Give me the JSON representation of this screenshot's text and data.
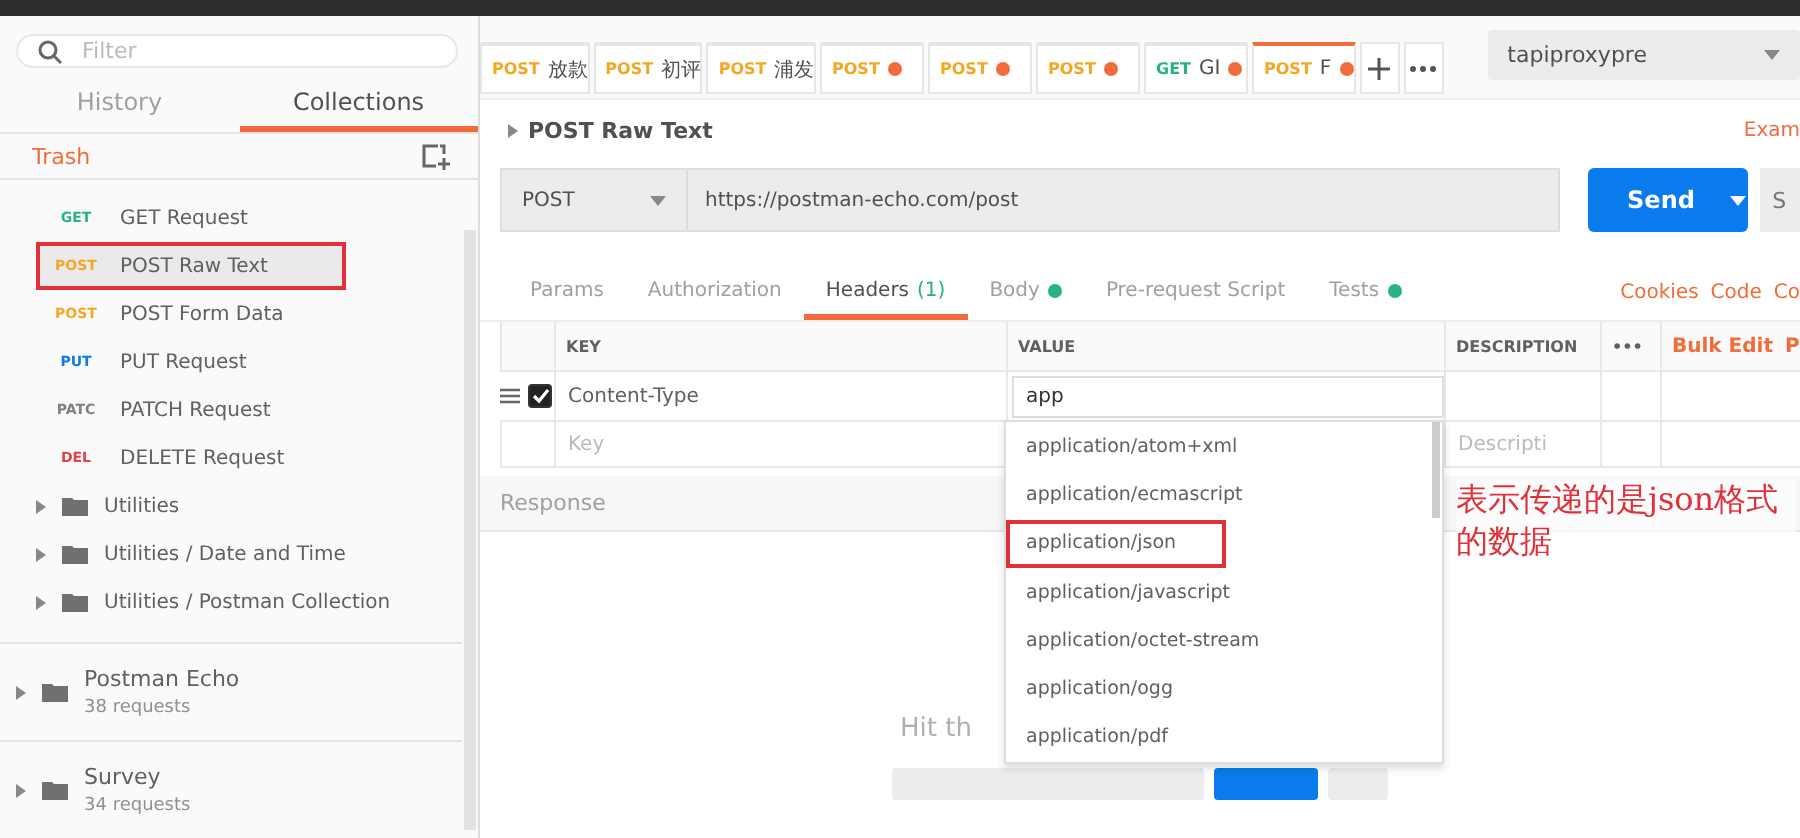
{
  "sidebar": {
    "filter": {
      "placeholder": "Filter"
    },
    "tabs": [
      {
        "label": "History",
        "selected": false
      },
      {
        "label": "Collections",
        "selected": true
      }
    ],
    "trash": "Trash",
    "requests": [
      {
        "method": "GET",
        "name": "GET Request",
        "highlighted": false
      },
      {
        "method": "POST",
        "name": "POST Raw Text",
        "highlighted": true
      },
      {
        "method": "POST",
        "name": "POST Form Data",
        "highlighted": false
      },
      {
        "method": "PUT",
        "name": "PUT Request",
        "highlighted": false
      },
      {
        "method": "PATC",
        "name": "PATCH Request",
        "highlighted": false
      },
      {
        "method": "DEL",
        "name": "DELETE Request",
        "highlighted": false
      }
    ],
    "folders": [
      "Utilities",
      "Utilities / Date and Time",
      "Utilities / Postman Collection"
    ],
    "collections": [
      {
        "name": "Postman Echo",
        "count": "38 requests"
      },
      {
        "name": "Survey",
        "count": "34 requests"
      }
    ]
  },
  "request_tabs": [
    {
      "method": "POST",
      "label": "放款",
      "unsaved": false,
      "selected": false
    },
    {
      "method": "POST",
      "label": "初评",
      "unsaved": false,
      "selected": false
    },
    {
      "method": "POST",
      "label": "浦发",
      "unsaved": false,
      "selected": false
    },
    {
      "method": "POST",
      "unsaved": true,
      "selected": false
    },
    {
      "method": "POST",
      "unsaved": true,
      "selected": false
    },
    {
      "method": "POST",
      "unsaved": true,
      "selected": false
    },
    {
      "method": "GET",
      "label": "GI",
      "unsaved": true,
      "selected": false
    },
    {
      "method": "POST",
      "label": "F",
      "unsaved": true,
      "selected": true
    }
  ],
  "environment": "tapiproxypre",
  "request": {
    "title": "POST Raw Text",
    "examples_link": "Exam",
    "method": "POST",
    "url": "https://postman-echo.com/post",
    "send": "Send",
    "save": "S"
  },
  "sections": [
    {
      "label": "Params",
      "selected": false
    },
    {
      "label": "Authorization",
      "selected": false
    },
    {
      "label": "Headers",
      "count": "(1)",
      "selected": true
    },
    {
      "label": "Body",
      "dot": true,
      "selected": false
    },
    {
      "label": "Pre-request Script",
      "selected": false
    },
    {
      "label": "Tests",
      "dot": true,
      "selected": false
    }
  ],
  "links": [
    "Cookies",
    "Code",
    "Co"
  ],
  "headers": {
    "columns": [
      "KEY",
      "VALUE",
      "DESCRIPTION"
    ],
    "more": "•••",
    "bulk_edit": "Bulk Edit",
    "extra": "P",
    "rows": [
      {
        "key": "Content-Type",
        "value": "app",
        "checked": true
      }
    ],
    "new_row": {
      "key_placeholder": "Key",
      "description_placeholder": "Descripti"
    }
  },
  "suggestions": [
    {
      "label": "application/atom+xml",
      "highlighted": false
    },
    {
      "label": "application/ecmascript",
      "highlighted": false
    },
    {
      "label": "application/json",
      "highlighted": true
    },
    {
      "label": "application/javascript",
      "highlighted": false
    },
    {
      "label": "application/octet-stream",
      "highlighted": false
    },
    {
      "label": "application/ogg",
      "highlighted": false
    },
    {
      "label": "application/pdf",
      "highlighted": false
    }
  ],
  "annotation": "表示传递的是json格式的数据",
  "response": {
    "title": "Response",
    "hint": "Hit th"
  }
}
